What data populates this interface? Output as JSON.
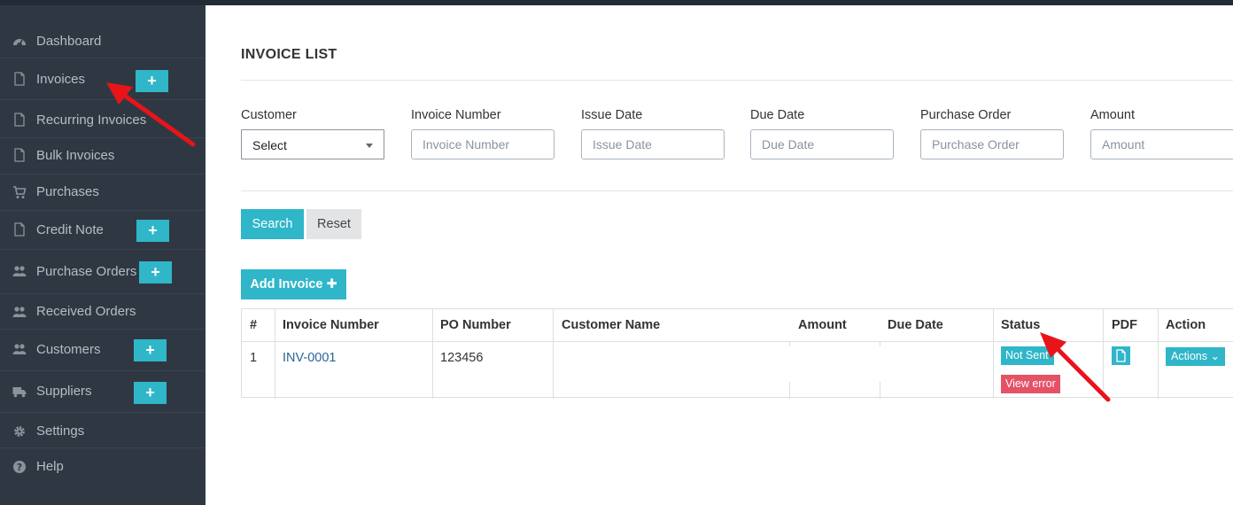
{
  "sidebar": {
    "items": [
      {
        "label": "Dashboard",
        "icon": "dashboard-icon",
        "plus": false
      },
      {
        "label": "Invoices",
        "icon": "file-icon",
        "plus": true
      },
      {
        "label": "Recurring Invoices",
        "icon": "file-icon",
        "plus": false
      },
      {
        "label": "Bulk Invoices",
        "icon": "file-icon",
        "plus": false
      },
      {
        "label": "Purchases",
        "icon": "cart-icon",
        "plus": false
      },
      {
        "label": "Credit Note",
        "icon": "file-icon",
        "plus": true
      },
      {
        "label": "Purchase Orders",
        "icon": "users-icon",
        "plus": true
      },
      {
        "label": "Received Orders",
        "icon": "users-icon",
        "plus": false
      },
      {
        "label": "Customers",
        "icon": "users-icon",
        "plus": true
      },
      {
        "label": "Suppliers",
        "icon": "truck-icon",
        "plus": true
      },
      {
        "label": "Settings",
        "icon": "gear-icon",
        "plus": false
      },
      {
        "label": "Help",
        "icon": "help-icon",
        "plus": false
      }
    ],
    "plus_symbol": "+"
  },
  "page": {
    "title": "INVOICE LIST"
  },
  "filters": {
    "customer": {
      "label": "Customer",
      "value": "Select"
    },
    "invoice_number": {
      "label": "Invoice Number",
      "placeholder": "Invoice Number"
    },
    "issue_date": {
      "label": "Issue Date",
      "placeholder": "Issue Date"
    },
    "due_date": {
      "label": "Due Date",
      "placeholder": "Due Date"
    },
    "purchase_order": {
      "label": "Purchase Order",
      "placeholder": "Purchase Order"
    },
    "amount": {
      "label": "Amount",
      "placeholder": "Amount"
    }
  },
  "buttons": {
    "search": "Search",
    "reset": "Reset",
    "add_invoice": "Add Invoice ✚"
  },
  "table": {
    "headers": [
      "#",
      "Invoice Number",
      "PO Number",
      "Customer Name",
      "Amount",
      "Due Date",
      "Status",
      "PDF",
      "Action"
    ],
    "rows": [
      {
        "num": "1",
        "invoice_number": "INV-0001",
        "po_number": "123456",
        "customer_name": "",
        "amount": "",
        "due_date": "",
        "status": "Not Sent",
        "error": "View error",
        "action": "Actions ⌄"
      }
    ]
  },
  "colors": {
    "accent": "#2fb6c9",
    "danger": "#e55266",
    "sidebar": "#2f3842",
    "annotation_arrow": "#e8141a"
  }
}
